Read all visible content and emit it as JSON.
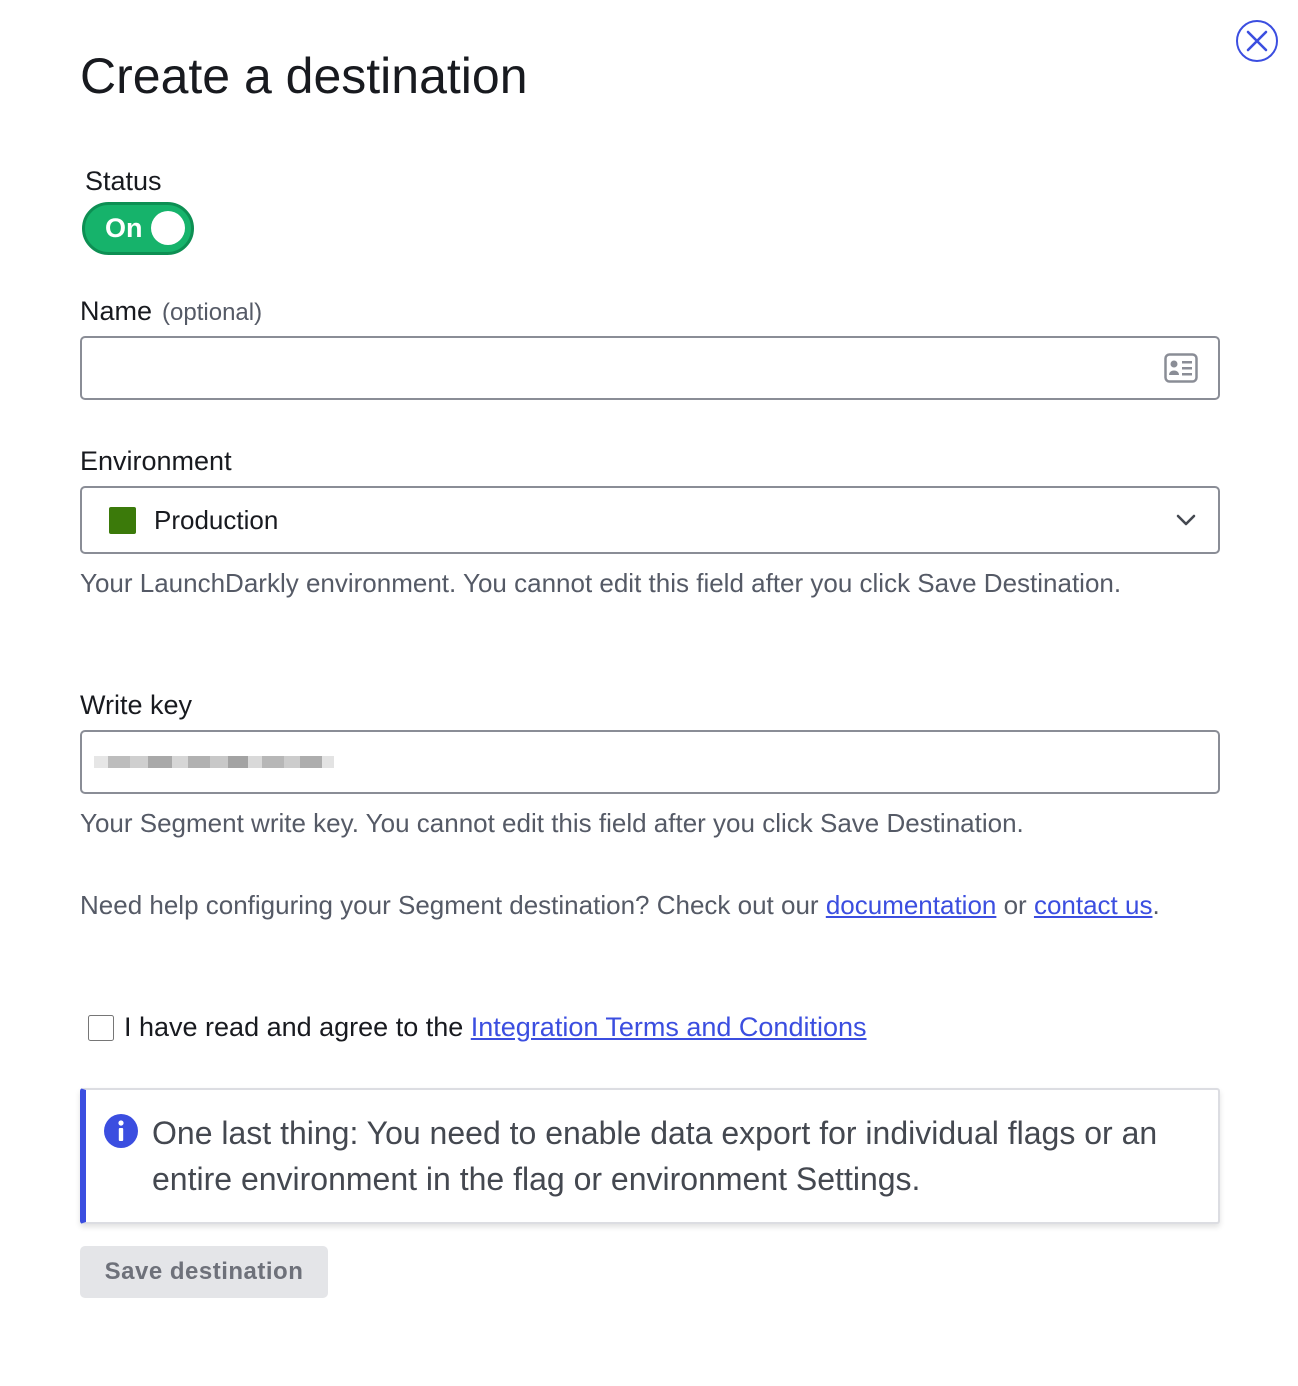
{
  "dialog": {
    "title": "Create a destination",
    "close_icon": "close-icon"
  },
  "status": {
    "label": "Status",
    "toggle_text": "On",
    "toggle_color": "#16b36b",
    "enabled": true
  },
  "name_field": {
    "label": "Name",
    "optional": "(optional)",
    "value": "",
    "placeholder": "",
    "icon": "contact-card-icon"
  },
  "environment": {
    "label": "Environment",
    "selected": "Production",
    "swatch_color": "#3b7a0a",
    "help": "Your LaunchDarkly environment. You cannot edit this field after you click Save Destination."
  },
  "write_key": {
    "label": "Write key",
    "value_obscured": true,
    "help": "Your Segment write key. You cannot edit this field after you click Save Destination."
  },
  "help_section": {
    "text_before": "Need help configuring your Segment destination? Check out our ",
    "doc_link": "documentation",
    "text_middle": " or ",
    "contact_link": "contact us",
    "text_after": "."
  },
  "terms": {
    "text": "I have read and agree to the ",
    "link": "Integration Terms and Conditions",
    "checked": false
  },
  "callout": {
    "icon": "info-icon",
    "text": "One last thing: You need to enable data export for individual flags or an entire environment in the flag or environment Settings.",
    "accent": "#3b4ee0"
  },
  "save_button": {
    "label": "Save destination",
    "disabled": true
  }
}
